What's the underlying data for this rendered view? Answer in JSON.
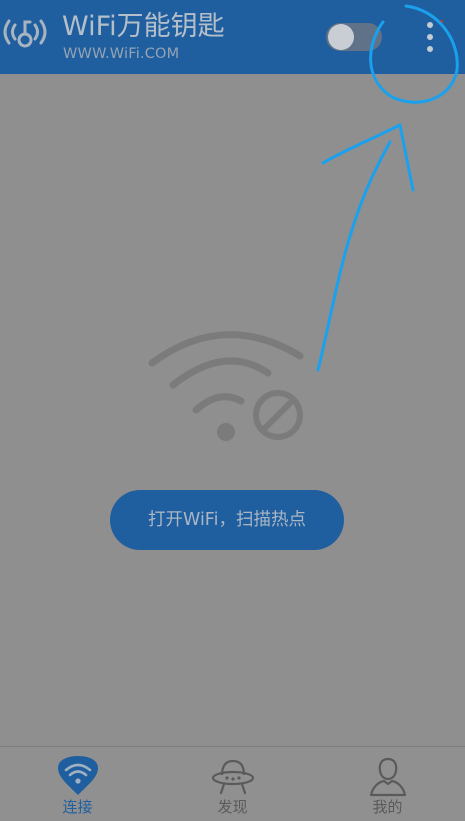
{
  "header": {
    "title": "WiFi万能钥匙",
    "subtitle": "WWW.WiFi.COM",
    "logo_icon": "wifi-key-logo-icon",
    "toggle_state": "off",
    "more_icon": "more-vertical-icon"
  },
  "main": {
    "status_icon": "wifi-disabled-icon",
    "scan_button_label": "打开WiFi，扫描热点"
  },
  "tabbar": {
    "tabs": [
      {
        "label": "连接",
        "icon": "wifi-tab-icon",
        "active": true
      },
      {
        "label": "发现",
        "icon": "ufo-discover-icon",
        "active": false
      },
      {
        "label": "我的",
        "icon": "user-icon",
        "active": false
      }
    ]
  },
  "colors": {
    "header_bg": "#1f5f9f",
    "page_bg": "#8f8f8f",
    "annotation": "#1aa1ee"
  }
}
